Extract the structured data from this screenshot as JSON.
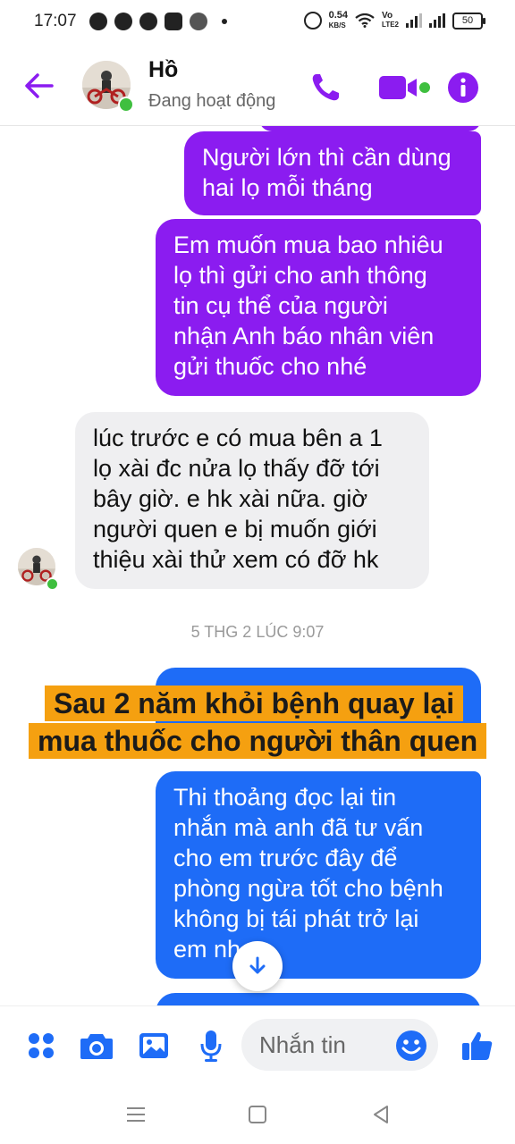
{
  "status_bar": {
    "time": "17:07",
    "net_speed_value": "0.54",
    "net_speed_unit": "KB/S",
    "volte_top": "Vo",
    "volte_bottom": "LTE2",
    "battery": "50"
  },
  "header": {
    "contact_name": "Hồ",
    "contact_status": "Đang hoạt động",
    "accent_color": "#8b1cf0"
  },
  "messages": [
    {
      "direction": "outgoing",
      "text": "Người lớn thì cần dùng\nhai lọ mỗi tháng"
    },
    {
      "direction": "outgoing",
      "text": "Em muốn mua bao nhiêu\nlọ thì gửi cho anh thông\ntin cụ thể của người\nnhận Anh báo nhân viên\ngửi thuốc cho nhé"
    },
    {
      "direction": "incoming",
      "text": "lúc trước e có mua bên a 1\nlọ xài đc nửa lọ thấy đỡ tới\nbây giờ. e hk xài nữa. giờ\nngười quen e bị muốn giới\nthiệu xài thử xem có đỡ hk"
    },
    {
      "direction": "outgoing",
      "text": "Thi thoảng đọc lại tin\nnhắn mà anh đã tư vấn\ncho em trước đây để\nphòng ngừa tốt cho bệnh\nkhông bị tái phát trở lại\nem nh"
    }
  ],
  "timestamp": "5 THG 2 LÚC 9:07",
  "overlay_caption": {
    "line1": "Sau 2 năm khỏi bệnh quay lại",
    "line2": "mua thuốc cho người thân quen"
  },
  "composer": {
    "placeholder": "Nhắn tin"
  },
  "icons": {
    "back": "back-arrow-icon",
    "call": "phone-icon",
    "video": "video-camera-icon",
    "info": "info-icon",
    "apps": "apps-grid-icon",
    "camera": "camera-icon",
    "gallery": "image-gallery-icon",
    "mic": "microphone-icon",
    "emoji": "emoji-icon",
    "like": "thumbs-up-icon",
    "scroll": "arrow-down-icon"
  },
  "colors": {
    "outgoing_purple": "#8b1cf0",
    "outgoing_blue": "#1e6cf7",
    "incoming_gray": "#efeff1",
    "messenger_blue": "#1e6cf7",
    "online_green": "#3fbf3f",
    "overlay_orange": "#f5a010"
  }
}
